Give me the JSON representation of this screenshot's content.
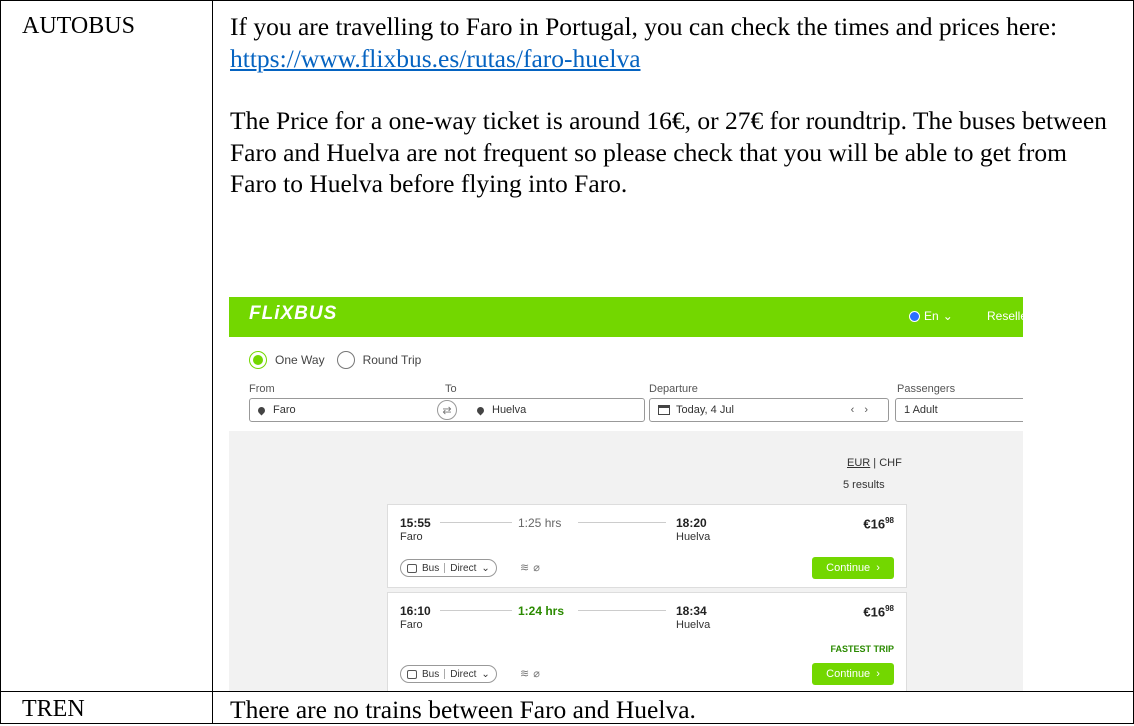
{
  "table": {
    "rows": [
      {
        "label": "AUTOBUS",
        "paragraph1": "If you are travelling to Faro in Portugal, you can check the times and prices here:",
        "link": "https://www.flixbus.es/rutas/faro-huelva",
        "paragraph2": "The Price for a one-way ticket is around 16€, or 27€ for roundtrip. The buses between Faro and Huelva are not frequent so please check that you will be able to get from Faro to Huelva before flying into Faro."
      },
      {
        "label": "TREN",
        "text": "There are no trains between Faro and Huelva."
      }
    ]
  },
  "screenshot": {
    "brand": "FLiXBUS",
    "brand_color": "#73d700",
    "language": "En",
    "reseller": "Reseller l",
    "trip_types": [
      "One Way",
      "Round Trip"
    ],
    "selected_trip_type": "One Way",
    "labels": {
      "from": "From",
      "to": "To",
      "departure": "Departure",
      "passengers": "Passengers"
    },
    "from": "Faro",
    "to": "Huelva",
    "departure": "Today, 4 Jul",
    "passengers": "1 Adult",
    "currency_eur": "EUR",
    "currency_sep": "|",
    "currency_chf": "CHF",
    "results_count": "5 results",
    "results": [
      {
        "dep_time": "15:55",
        "dep_city": "Faro",
        "duration": "1:25 hrs",
        "arr_time": "18:20",
        "arr_city": "Huelva",
        "price_main": "€16",
        "price_cents": "98",
        "badge": "",
        "type": "Bus",
        "route": "Direct",
        "button": "Continue"
      },
      {
        "dep_time": "16:10",
        "dep_city": "Faro",
        "duration": "1:24 hrs",
        "arr_time": "18:34",
        "arr_city": "Huelva",
        "price_main": "€16",
        "price_cents": "98",
        "badge": "FASTEST TRIP",
        "type": "Bus",
        "route": "Direct",
        "button": "Continue"
      }
    ]
  }
}
